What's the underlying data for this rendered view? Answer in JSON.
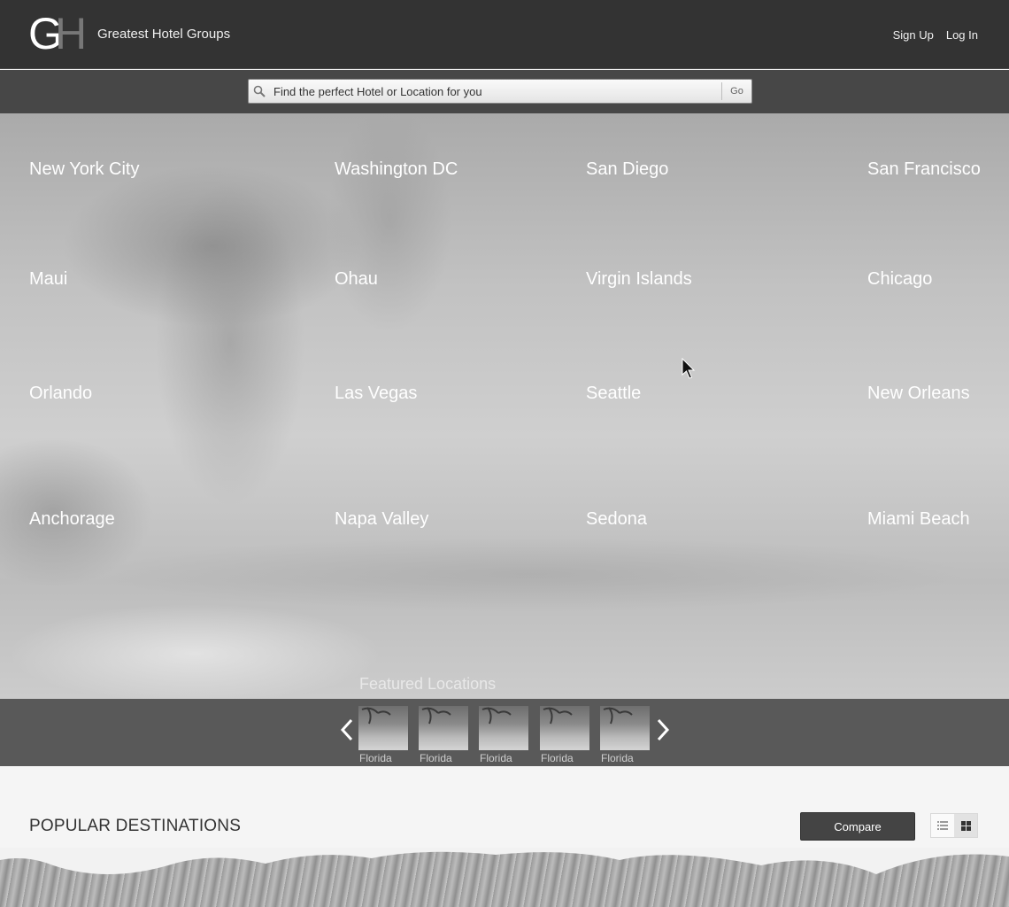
{
  "header": {
    "logo_letters": "GH",
    "brand_name": "Greatest Hotel Groups",
    "sign_up": "Sign Up",
    "log_in": "Log In"
  },
  "search": {
    "placeholder": "Find the perfect Hotel or Location for you",
    "go_label": "Go"
  },
  "hero": {
    "cities": [
      "New York City",
      "Washington DC",
      "San Diego",
      "San Francisco",
      "Maui",
      "Ohau",
      "Virgin Islands",
      "Chicago",
      "Orlando",
      "Las Vegas",
      "Seattle",
      "New Orleans",
      "Anchorage",
      "Napa Valley",
      "Sedona",
      "Miami Beach"
    ],
    "featured_title": "Featured Locations"
  },
  "carousel": {
    "items": [
      {
        "label": "Florida"
      },
      {
        "label": "Florida"
      },
      {
        "label": "Florida"
      },
      {
        "label": "Florida"
      },
      {
        "label": "Florida"
      }
    ]
  },
  "popular": {
    "title": "POPULAR DESTINATIONS",
    "compare_label": "Compare",
    "view_mode": "grid"
  },
  "colors": {
    "header_bg": "#333333",
    "search_strip_bg": "#474747",
    "carousel_bg": "#595959",
    "compare_bg": "#444444"
  },
  "icons": [
    "search-icon",
    "chevron-left-icon",
    "chevron-right-icon",
    "list-view-icon",
    "grid-view-icon"
  ]
}
